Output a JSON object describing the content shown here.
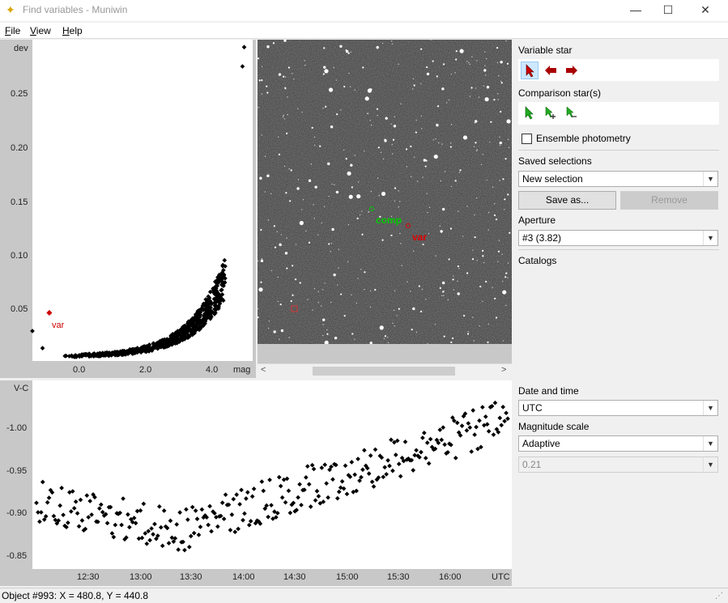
{
  "window": {
    "title": "Find variables - Muniwin",
    "controls": {
      "minimize": "—",
      "maximize": "☐",
      "close": "✕"
    }
  },
  "menu": {
    "items": [
      "File",
      "View",
      "Help"
    ]
  },
  "scatter_plot": {
    "y_title": "dev",
    "x_unit": "mag",
    "y_ticks": [
      "0.25",
      "0.20",
      "0.15",
      "0.10",
      "0.05"
    ],
    "x_ticks": [
      "0.0",
      "2.0",
      "4.0"
    ],
    "var_label": "var"
  },
  "chart_data": [
    {
      "type": "scatter",
      "title": "",
      "xlabel": "mag",
      "ylabel": "dev",
      "xlim": [
        -1.4,
        5.1
      ],
      "ylim": [
        0.0,
        0.3
      ],
      "highlight": {
        "label": "var",
        "x": -0.9,
        "y": 0.045,
        "color": "#cc0000"
      },
      "trend": "deviation rises exponentially with magnitude, dense cluster of several hundred stars"
    },
    {
      "type": "scatter",
      "title": "",
      "xlabel": "UTC",
      "ylabel": "V-C",
      "ylim": [
        -0.83,
        -1.05
      ],
      "x_ticks": [
        "12:30",
        "13:00",
        "13:30",
        "14:00",
        "14:30",
        "15:00",
        "15:30",
        "16:00"
      ],
      "y_ticks": [
        "-1.00",
        "-0.95",
        "-0.90",
        "-0.85"
      ]
    }
  ],
  "image_view": {
    "comp_label": "comp",
    "var_label": "var"
  },
  "light_curve": {
    "y_title": "V-C",
    "x_unit": "UTC",
    "y_ticks": [
      "-1.00",
      "-0.95",
      "-0.90",
      "-0.85"
    ],
    "x_ticks": [
      "12:30",
      "13:00",
      "13:30",
      "14:00",
      "14:30",
      "15:00",
      "15:30",
      "16:00"
    ]
  },
  "right_panel": {
    "variable_star_label": "Variable star",
    "comparison_label": "Comparison star(s)",
    "ensemble_label": "Ensemble photometry",
    "ensemble_checked": false,
    "saved_selections_label": "Saved selections",
    "saved_selection_value": "New selection",
    "save_as_label": "Save as...",
    "remove_label": "Remove",
    "aperture_label": "Aperture",
    "aperture_value": "#3 (3.82)",
    "catalogs_label": "Catalogs"
  },
  "lower_right_panel": {
    "date_time_label": "Date and time",
    "date_time_value": "UTC",
    "magnitude_scale_label": "Magnitude scale",
    "magnitude_scale_value": "Adaptive",
    "magnitude_range_value": "0.21"
  },
  "status": {
    "text": "Object #993: X = 480.8, Y = 440.8"
  },
  "colors": {
    "accent_red": "#cc0000",
    "accent_green": "#00aa00",
    "plot_gray": "#c8c8c8"
  }
}
